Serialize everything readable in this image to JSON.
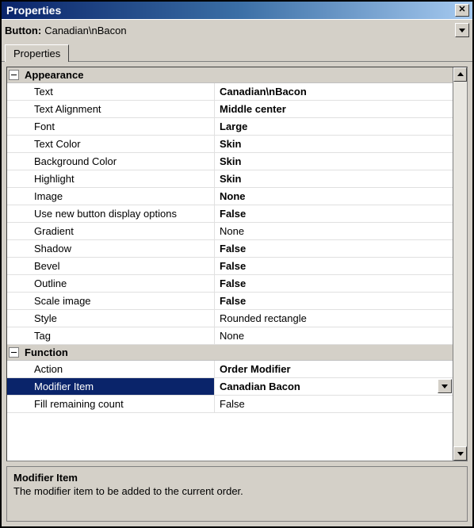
{
  "title": "Properties",
  "object": {
    "label": "Button:",
    "value": "Canadian\\nBacon"
  },
  "tabs": [
    {
      "label": "Properties"
    }
  ],
  "categories": [
    {
      "name": "Appearance",
      "rows": [
        {
          "name": "Text",
          "value": "Canadian\\nBacon",
          "bold": true
        },
        {
          "name": "Text Alignment",
          "value": "Middle center",
          "bold": true
        },
        {
          "name": "Font",
          "value": "Large",
          "bold": true
        },
        {
          "name": "Text Color",
          "value": "Skin",
          "bold": true
        },
        {
          "name": "Background Color",
          "value": "Skin",
          "bold": true
        },
        {
          "name": "Highlight",
          "value": "Skin",
          "bold": true
        },
        {
          "name": "Image",
          "value": "None",
          "bold": true
        },
        {
          "name": "Use new button display options",
          "value": "False",
          "bold": true
        },
        {
          "name": "Gradient",
          "value": "None",
          "bold": false
        },
        {
          "name": "Shadow",
          "value": "False",
          "bold": true
        },
        {
          "name": "Bevel",
          "value": "False",
          "bold": true
        },
        {
          "name": "Outline",
          "value": "False",
          "bold": true
        },
        {
          "name": "Scale image",
          "value": "False",
          "bold": true
        },
        {
          "name": "Style",
          "value": "Rounded rectangle",
          "bold": false
        },
        {
          "name": "Tag",
          "value": "None",
          "bold": false
        }
      ]
    },
    {
      "name": "Function",
      "rows": [
        {
          "name": "Action",
          "value": "Order Modifier",
          "bold": true
        },
        {
          "name": "Modifier Item",
          "value": "Canadian Bacon",
          "bold": true,
          "selected": true,
          "dropdown": true
        },
        {
          "name": "Fill remaining count",
          "value": "False",
          "bold": false
        }
      ]
    }
  ],
  "description": {
    "title": "Modifier Item",
    "text": "The modifier item to be added to the current order."
  }
}
